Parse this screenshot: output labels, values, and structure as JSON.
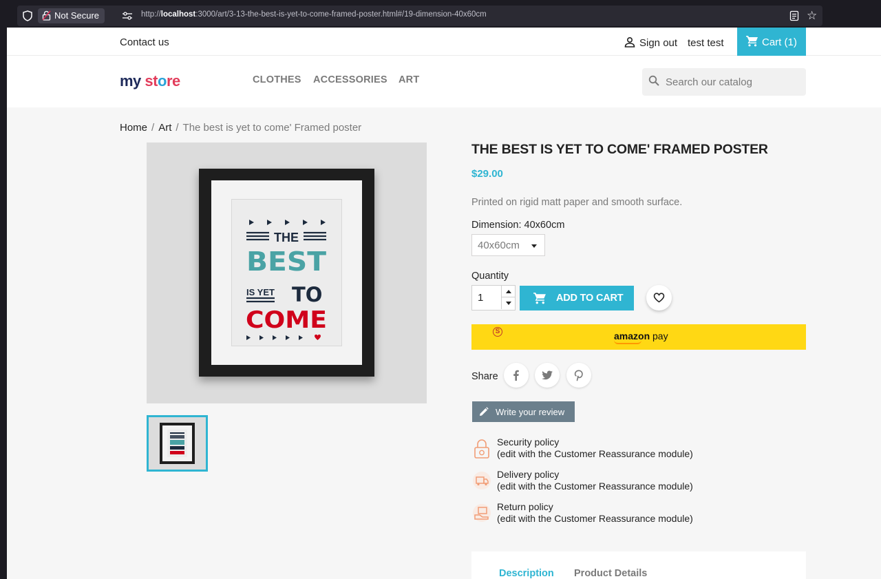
{
  "browser": {
    "security_label": "Not Secure",
    "url_prefix": "http://",
    "url_host": "localhost",
    "url_rest": ":3000/art/3-13-the-best-is-yet-to-come-framed-poster.html#/19-dimension-40x60cm"
  },
  "nav": {
    "contact": "Contact us",
    "sign_out": "Sign out",
    "username": "test test",
    "cart": "Cart (1)"
  },
  "header": {
    "logo": {
      "part1": "my ",
      "part2": "st",
      "part3": "o",
      "part4": "re"
    },
    "menu": [
      "CLOTHES",
      "ACCESSORIES",
      "ART"
    ],
    "search_placeholder": "Search our catalog"
  },
  "breadcrumb": {
    "home": "Home",
    "category": "Art",
    "current": "The best is yet to come' Framed poster",
    "separator": "/"
  },
  "product": {
    "title": "THE BEST IS YET TO COME' FRAMED POSTER",
    "price": "$29.00",
    "description": "Printed on rigid matt paper and smooth surface.",
    "dimension_label": "Dimension: 40x60cm",
    "dimension_value": "40x60cm",
    "quantity_label": "Quantity",
    "quantity_value": "1",
    "add_to_cart": "ADD TO CART",
    "amazon_pay": {
      "brand": "amazon",
      "text": " pay",
      "badge": "S"
    },
    "share_label": "Share",
    "write_review": "Write your review",
    "poster": {
      "the": "THE",
      "best": "BEST",
      "isyet": "IS YET",
      "to": "TO",
      "come": "COME"
    }
  },
  "reassurance": [
    {
      "title": "Security policy",
      "sub": "(edit with the Customer Reassurance module)"
    },
    {
      "title": "Delivery policy",
      "sub": "(edit with the Customer Reassurance module)"
    },
    {
      "title": "Return policy",
      "sub": "(edit with the Customer Reassurance module)"
    }
  ],
  "tabs": [
    "Description",
    "Product Details"
  ],
  "colors": {
    "accent": "#2fb5d2",
    "amazon_yellow": "#ffd814",
    "poster_teal": "#4aa3a5",
    "poster_red": "#d0021b",
    "poster_navy": "#1c2a3d"
  },
  "icons": [
    "shield-icon",
    "lock-icon",
    "permissions-icon",
    "reader-view-icon",
    "bookmark-star-icon",
    "user-icon",
    "cart-icon",
    "search-icon",
    "heart-icon",
    "facebook-icon",
    "twitter-icon",
    "pinterest-icon",
    "pencil-icon",
    "security-icon",
    "delivery-icon",
    "return-icon"
  ]
}
